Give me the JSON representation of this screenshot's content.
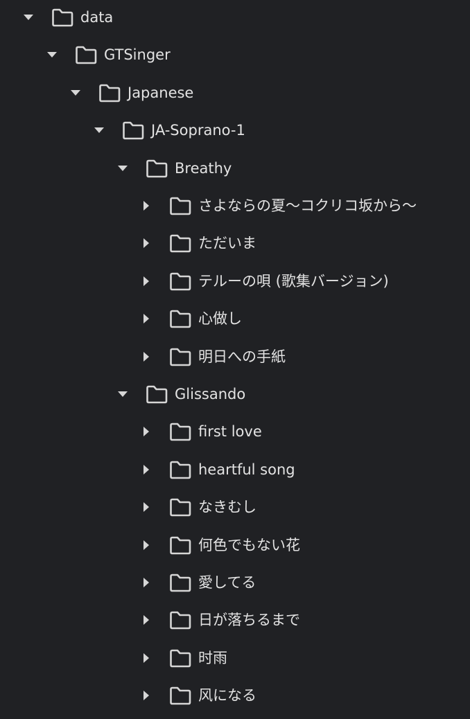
{
  "tree": {
    "icons": {
      "expanded": "caret-down-icon",
      "collapsed": "caret-right-icon",
      "folder": "folder-icon"
    },
    "colors": {
      "background": "#202124",
      "text": "#e3e3e3",
      "icon": "#d6d6d6"
    },
    "nodes": [
      {
        "id": "data",
        "label": "data",
        "depth": 0,
        "expanded": true
      },
      {
        "id": "gtsinger",
        "label": "GTSinger",
        "depth": 1,
        "expanded": true
      },
      {
        "id": "japanese",
        "label": "Japanese",
        "depth": 2,
        "expanded": true
      },
      {
        "id": "ja-soprano-1",
        "label": "JA-Soprano-1",
        "depth": 3,
        "expanded": true
      },
      {
        "id": "breathy",
        "label": "Breathy",
        "depth": 4,
        "expanded": true
      },
      {
        "id": "sayonara",
        "label": "さよならの夏〜コクリコ坂から〜",
        "depth": 5,
        "expanded": false
      },
      {
        "id": "tadaima",
        "label": "ただいま",
        "depth": 5,
        "expanded": false
      },
      {
        "id": "teru",
        "label": "テルーの唄 (歌集バージョン)",
        "depth": 5,
        "expanded": false
      },
      {
        "id": "kokoro",
        "label": "心做し",
        "depth": 5,
        "expanded": false
      },
      {
        "id": "ashita",
        "label": "明日への手紙",
        "depth": 5,
        "expanded": false
      },
      {
        "id": "glissando",
        "label": "Glissando",
        "depth": 4,
        "expanded": true
      },
      {
        "id": "first-love",
        "label": "first love",
        "depth": 5,
        "expanded": false
      },
      {
        "id": "heartful-song",
        "label": "heartful song",
        "depth": 5,
        "expanded": false
      },
      {
        "id": "nakimushi",
        "label": "なきむし",
        "depth": 5,
        "expanded": false
      },
      {
        "id": "naniiro",
        "label": "何色でもない花",
        "depth": 5,
        "expanded": false
      },
      {
        "id": "aishiteru",
        "label": "愛してる",
        "depth": 5,
        "expanded": false
      },
      {
        "id": "higaochiru",
        "label": "日が落ちるまで",
        "depth": 5,
        "expanded": false
      },
      {
        "id": "shigure",
        "label": "时雨",
        "depth": 5,
        "expanded": false
      },
      {
        "id": "kaze",
        "label": "风になる",
        "depth": 5,
        "expanded": false
      }
    ]
  }
}
